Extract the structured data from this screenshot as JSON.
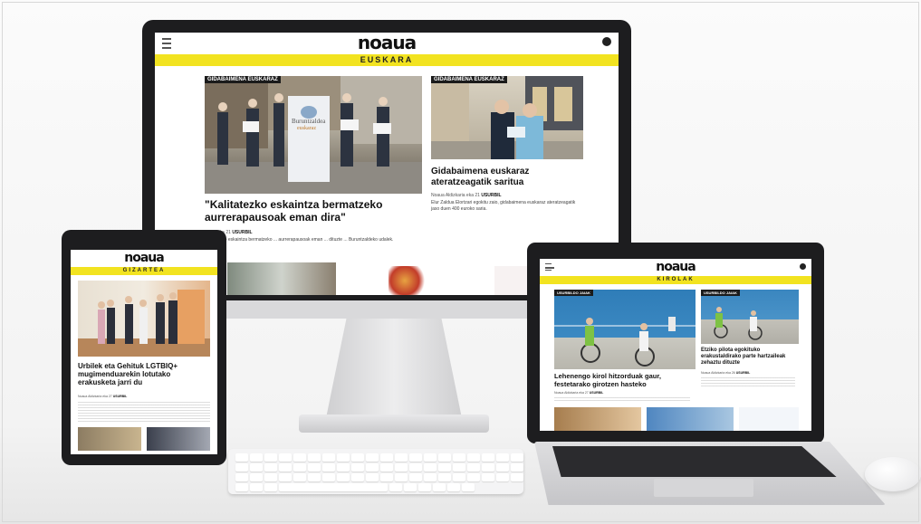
{
  "brand": {
    "logo": "noaua",
    "accent": "#f2e320"
  },
  "monitor": {
    "section": "EUSKARA",
    "article1": {
      "tag": "GIDABAIMENA EUSKARAZ",
      "title": "\"Kalitatezko eskaintza bermatzeko aurrerapausoak eman dira\"",
      "meta_author": "maria",
      "meta_date": "eka 21",
      "meta_place": "USURBIL",
      "lead": "Kalitatezko eskaintza bermatzeko ... aurrerapausoak eman ... dituzte ... Buruntzaldeko udalek.",
      "banner_line1": "Buruntzaldea",
      "banner_line2": "euskaraz"
    },
    "article2": {
      "tag": "GIDABAIMENA EUSKARAZ",
      "title": "Gidabaimena euskaraz ateratzeagatik saritua",
      "meta_author": "Noaua Aldizkaria",
      "meta_date": "eka 21",
      "meta_place": "USURBIL",
      "lead": "Elur Zaldua Elortzari egokitu zaio, gidabaimena euskaraz ateratzeagatik jaso duen 400 euroko saria."
    }
  },
  "tablet": {
    "section": "GIZARTEA",
    "title": "Urbilek eta Gehituk LGTBIQ+ mugimenduarekin lotutako erakusketa jarri du",
    "meta_author": "Noaua Aldizkaria",
    "meta_date": "eka 27",
    "meta_place": "USURBIL"
  },
  "laptop": {
    "section": "KIROLAK",
    "article1": {
      "tag": "USURBILDO JAIAK",
      "title": "Lehenengo kirol hitzorduak gaur, festetarako girotzen hasteko",
      "meta_author": "Noaua Aldizkaria",
      "meta_date": "eka 27",
      "meta_place": "USURBIL"
    },
    "article2": {
      "tag": "USURBILDO JAIAK",
      "title": "Etziko pilota egokituko erakustaldirako parte hartzaileak zehaztu dituzte",
      "meta_author": "Noaua Aldizkaria",
      "meta_date": "eka 26",
      "meta_place": "USURBIL"
    }
  }
}
